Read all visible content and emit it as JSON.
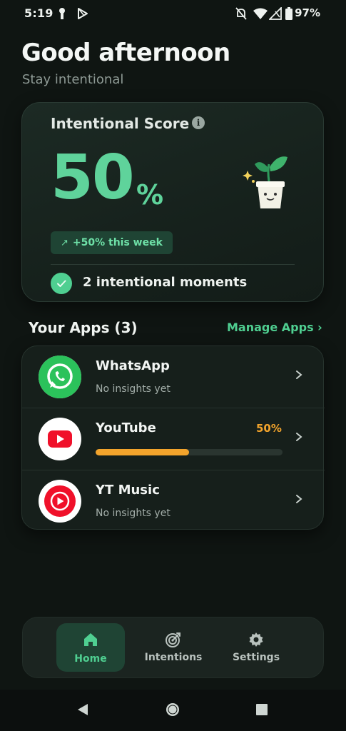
{
  "status_bar": {
    "time": "5:19",
    "battery_percent": "97%"
  },
  "header": {
    "greeting": "Good afternoon",
    "subtitle": "Stay intentional"
  },
  "score_card": {
    "title": "Intentional Score",
    "info_icon": "i",
    "score_value": "50",
    "score_unit": "%",
    "trend": "+50% this week",
    "trend_arrow": "↗",
    "moments": "2 intentional moments"
  },
  "apps_section": {
    "title": "Your Apps (3)",
    "manage_link": "Manage Apps ›",
    "apps": [
      {
        "name": "WhatsApp",
        "subtitle": "No insights yet",
        "icon": "whatsapp-icon"
      },
      {
        "name": "YouTube",
        "percent_label": "50%",
        "progress": 0.5,
        "icon": "youtube-icon"
      },
      {
        "name": "YT Music",
        "subtitle": "No insights yet",
        "icon": "yt-music-icon"
      }
    ]
  },
  "bottom_nav": {
    "items": [
      {
        "label": "Home",
        "icon": "home-icon",
        "active": true
      },
      {
        "label": "Intentions",
        "icon": "target-icon",
        "active": false
      },
      {
        "label": "Settings",
        "icon": "gear-icon",
        "active": false
      }
    ]
  },
  "colors": {
    "background": "#0f1512",
    "accent_green": "#4fcf91",
    "score_green": "#5fd39b",
    "progress_orange": "#f3a42c"
  }
}
